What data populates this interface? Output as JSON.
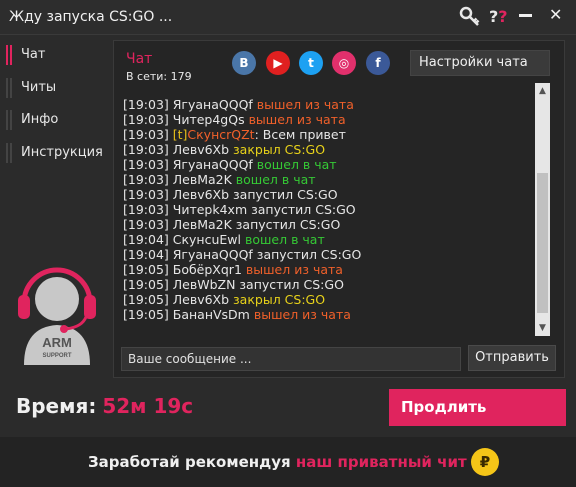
{
  "window": {
    "title": "Жду запуска CS:GO ...",
    "help_label": "?"
  },
  "sidebar": {
    "items": [
      {
        "label": "Чат",
        "active": true
      },
      {
        "label": "Читы",
        "active": false
      },
      {
        "label": "Инфо",
        "active": false
      },
      {
        "label": "Инструкция",
        "active": false
      }
    ],
    "logo": {
      "line1": "ARM",
      "line2": "SUPPORT"
    }
  },
  "chat": {
    "title": "Чат",
    "online": "В сети: 179",
    "socials": [
      "В",
      "▶",
      "t",
      "◎",
      "f"
    ],
    "settings_label": "Настройки чата",
    "messages": [
      {
        "time": "[19:03]",
        "user": "ЯгуанаQQQf",
        "text": "вышел из чата",
        "type": "left"
      },
      {
        "time": "[19:03]",
        "user": "Читер4gQs",
        "text": "вышел из чата",
        "type": "left"
      },
      {
        "time": "[19:03]",
        "user": "[t]СкунсrQZt",
        "text": ": Всем привет",
        "type": "admin"
      },
      {
        "time": "[19:03]",
        "user": "Левv6Xb",
        "text": "закрыл CS:GO",
        "type": "closed"
      },
      {
        "time": "[19:03]",
        "user": "ЯгуанаQQQf",
        "text": "вошел в чат",
        "type": "joined"
      },
      {
        "time": "[19:03]",
        "user": "ЛевMa2K",
        "text": "вошел в чат",
        "type": "joined"
      },
      {
        "time": "[19:03]",
        "user": "Левv6Xb",
        "text": "запустил CS:GO",
        "type": "launch"
      },
      {
        "time": "[19:03]",
        "user": "Читерk4xm",
        "text": "запустил CS:GO",
        "type": "launch"
      },
      {
        "time": "[19:03]",
        "user": "ЛевMa2K",
        "text": "запустил CS:GO",
        "type": "launch"
      },
      {
        "time": "[19:04]",
        "user": "СкунсuEwl",
        "text": "вошел в чат",
        "type": "joined"
      },
      {
        "time": "[19:04]",
        "user": "ЯгуанаQQQf",
        "text": "запустил CS:GO",
        "type": "launch"
      },
      {
        "time": "[19:05]",
        "user": "БобёрXqr1",
        "text": "вышел из чата",
        "type": "left"
      },
      {
        "time": "[19:05]",
        "user": "ЛевWbZN",
        "text": "запустил CS:GO",
        "type": "launch"
      },
      {
        "time": "[19:05]",
        "user": "Левv6Xb",
        "text": "закрыл CS:GO",
        "type": "closed"
      },
      {
        "time": "[19:05]",
        "user": "БананVsDm",
        "text": "вышел из чата",
        "type": "left"
      }
    ],
    "input_placeholder": "Ваше сообщение ...",
    "send_label": "Отправить"
  },
  "timer": {
    "label": "Время:",
    "value": "52м 19с"
  },
  "extend_label": "Продлить",
  "promo": {
    "text": "Заработай рекомендуя",
    "link": "наш приватный чит",
    "coin": "₽"
  },
  "colors": {
    "accent": "#e0245e",
    "left": "#f0602a",
    "joined": "#35c935",
    "closed": "#e8d21a",
    "launch": "#e6e6e6",
    "admin_tag": "#e8c01a"
  }
}
